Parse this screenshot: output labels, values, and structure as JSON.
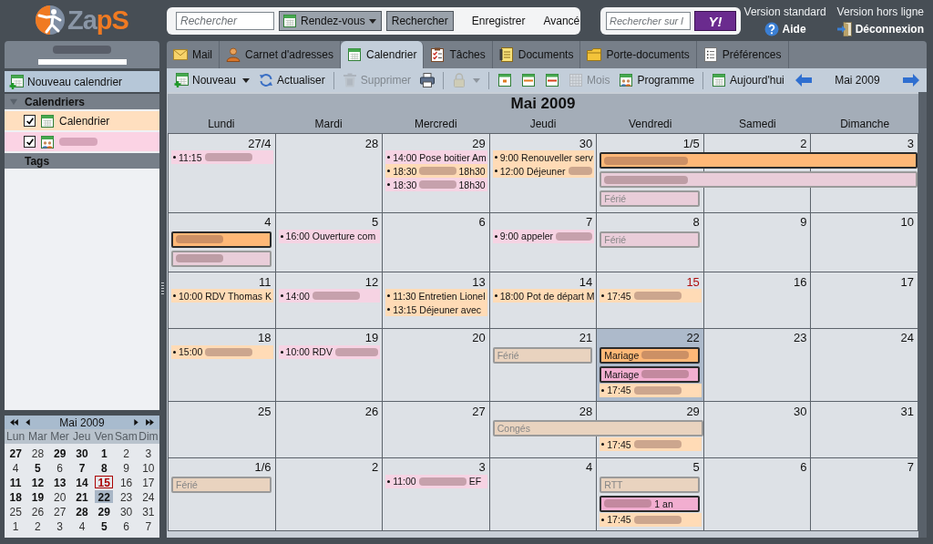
{
  "logo": {
    "parts": [
      "Za",
      "pS"
    ]
  },
  "search": {
    "placeholder": "Rechercher",
    "scope": "Rendez-vous",
    "button": "Rechercher",
    "links": [
      "Enregistrer",
      "Avancé"
    ]
  },
  "web_search": {
    "placeholder": "Rechercher sur l",
    "button": "Y!"
  },
  "header_links": [
    {
      "version": "Version standard",
      "action": "Aide"
    },
    {
      "version": "Version hors ligne",
      "action": "Déconnexion"
    }
  ],
  "sidebar": {
    "user": {
      "redacted": true
    },
    "new_calendar": "Nouveau calendrier",
    "calendars_header": {
      "title": "Calendriers",
      "expanded": true
    },
    "calendars": [
      {
        "kind": "own",
        "label": "Calendrier",
        "redacted": false,
        "checked": true,
        "color": "#ffdfbf"
      },
      {
        "kind": "shared",
        "redacted": true,
        "checked": true,
        "color": "#fbd3e4"
      }
    ],
    "tags_header": {
      "title": "Tags"
    }
  },
  "mini_calendar": {
    "title": "Mai 2009",
    "weekdays": [
      "Lun",
      "Mar",
      "Mer",
      "Jeu",
      "Ven",
      "Sam",
      "Dim"
    ],
    "weeks": [
      [
        {
          "day": "27",
          "has_events": true,
          "today": false,
          "selected": false
        },
        {
          "day": "28",
          "has_events": false,
          "today": false,
          "selected": false
        },
        {
          "day": "29",
          "has_events": true,
          "today": false,
          "selected": false
        },
        {
          "day": "30",
          "has_events": true,
          "today": false,
          "selected": false
        },
        {
          "day": "1",
          "has_events": true,
          "today": false,
          "selected": false
        },
        {
          "day": "2",
          "has_events": false,
          "today": false,
          "selected": false
        },
        {
          "day": "3",
          "has_events": false,
          "today": false,
          "selected": false
        }
      ],
      [
        {
          "day": "4",
          "has_events": false,
          "today": false,
          "selected": false
        },
        {
          "day": "5",
          "has_events": true,
          "today": false,
          "selected": false
        },
        {
          "day": "6",
          "has_events": false,
          "today": false,
          "selected": false
        },
        {
          "day": "7",
          "has_events": true,
          "today": false,
          "selected": false
        },
        {
          "day": "8",
          "has_events": true,
          "today": false,
          "selected": false
        },
        {
          "day": "9",
          "has_events": false,
          "today": false,
          "selected": false
        },
        {
          "day": "10",
          "has_events": false,
          "today": false,
          "selected": false
        }
      ],
      [
        {
          "day": "11",
          "has_events": true,
          "today": false,
          "selected": false
        },
        {
          "day": "12",
          "has_events": true,
          "today": false,
          "selected": false
        },
        {
          "day": "13",
          "has_events": true,
          "today": false,
          "selected": false
        },
        {
          "day": "14",
          "has_events": true,
          "today": false,
          "selected": false
        },
        {
          "day": "15",
          "has_events": true,
          "today": true,
          "selected": false
        },
        {
          "day": "16",
          "has_events": false,
          "today": false,
          "selected": false
        },
        {
          "day": "17",
          "has_events": false,
          "today": false,
          "selected": false
        }
      ],
      [
        {
          "day": "18",
          "has_events": true,
          "today": false,
          "selected": false
        },
        {
          "day": "19",
          "has_events": true,
          "today": false,
          "selected": false
        },
        {
          "day": "20",
          "has_events": false,
          "today": false,
          "selected": false
        },
        {
          "day": "21",
          "has_events": true,
          "today": false,
          "selected": false
        },
        {
          "day": "22",
          "has_events": true,
          "today": false,
          "selected": true
        },
        {
          "day": "23",
          "has_events": false,
          "today": false,
          "selected": false
        },
        {
          "day": "24",
          "has_events": false,
          "today": false,
          "selected": false
        }
      ],
      [
        {
          "day": "25",
          "has_events": false,
          "today": false,
          "selected": false
        },
        {
          "day": "26",
          "has_events": false,
          "today": false,
          "selected": false
        },
        {
          "day": "27",
          "has_events": false,
          "today": false,
          "selected": false
        },
        {
          "day": "28",
          "has_events": true,
          "today": false,
          "selected": false
        },
        {
          "day": "29",
          "has_events": true,
          "today": false,
          "selected": false
        },
        {
          "day": "30",
          "has_events": false,
          "today": false,
          "selected": false
        },
        {
          "day": "31",
          "has_events": false,
          "today": false,
          "selected": false
        }
      ],
      [
        {
          "day": "1",
          "has_events": false,
          "today": false,
          "selected": false
        },
        {
          "day": "2",
          "has_events": false,
          "today": false,
          "selected": false
        },
        {
          "day": "3",
          "has_events": false,
          "today": false,
          "selected": false
        },
        {
          "day": "4",
          "has_events": false,
          "today": false,
          "selected": false
        },
        {
          "day": "5",
          "has_events": true,
          "today": false,
          "selected": false
        },
        {
          "day": "6",
          "has_events": false,
          "today": false,
          "selected": false
        },
        {
          "day": "7",
          "has_events": false,
          "today": false,
          "selected": false
        }
      ]
    ]
  },
  "tabs": [
    {
      "label": "Mail",
      "selected": false
    },
    {
      "label": "Carnet d'adresses",
      "selected": false
    },
    {
      "label": "Calendrier",
      "selected": true
    },
    {
      "label": "Tâches",
      "selected": false
    },
    {
      "label": "Documents",
      "selected": false
    },
    {
      "label": "Porte-documents",
      "selected": false
    },
    {
      "label": "Préférences",
      "selected": false
    }
  ],
  "toolbar": [
    {
      "kind": "button",
      "label": "Nouveau",
      "dropdown": true,
      "disabled": false
    },
    {
      "kind": "button",
      "label": "Actualiser",
      "dropdown": false,
      "disabled": false
    },
    {
      "kind": "separator"
    },
    {
      "kind": "button",
      "label": "Supprimer",
      "dropdown": false,
      "disabled": true
    },
    {
      "kind": "button",
      "dropdown": false,
      "disabled": false
    },
    {
      "kind": "separator"
    },
    {
      "kind": "button",
      "dropdown": true,
      "disabled": true
    },
    {
      "kind": "separator"
    },
    {
      "kind": "button",
      "dropdown": false,
      "disabled": false
    },
    {
      "kind": "button",
      "dropdown": false,
      "disabled": false
    },
    {
      "kind": "button",
      "dropdown": false,
      "disabled": false
    },
    {
      "kind": "button",
      "label": "Mois",
      "dropdown": false,
      "disabled": true
    },
    {
      "kind": "button",
      "label": "Programme",
      "dropdown": false,
      "disabled": false
    },
    {
      "kind": "separator"
    },
    {
      "kind": "button",
      "label": "Aujourd'hui",
      "dropdown": false,
      "disabled": false
    }
  ],
  "period_nav": {
    "label": "Mai 2009"
  },
  "calendar": {
    "title": "Mai 2009",
    "weekdays": [
      "Lundi",
      "Mardi",
      "Mercredi",
      "Jeudi",
      "Vendredi",
      "Samedi",
      "Dimanche"
    ],
    "weeks": [
      {
        "days": [
          {
            "date": "27/4",
            "today": false,
            "selected": false,
            "events": [
              {
                "kind": "timed",
                "time": "11:15",
                "redacted": true,
                "color": "#f6d3e3"
              }
            ]
          },
          {
            "date": "28",
            "today": false,
            "selected": false
          },
          {
            "date": "29",
            "today": false,
            "selected": false,
            "events": [
              {
                "kind": "timed",
                "time": "14:00",
                "title": "Pose boitier Am",
                "redacted": false,
                "color": "#f6d3e3"
              },
              {
                "kind": "timed",
                "time": "18:30",
                "redacted": true,
                "suffix": "18h30",
                "color": "#ffdbb6"
              },
              {
                "kind": "timed",
                "time": "18:30",
                "redacted": true,
                "suffix": "18h30",
                "color": "#f6d3e3"
              }
            ]
          },
          {
            "date": "30",
            "today": false,
            "selected": false,
            "events": [
              {
                "kind": "timed",
                "time": "9:00",
                "title": "Renouveller serv",
                "redacted": false,
                "color": "#ffdbb6"
              },
              {
                "kind": "timed",
                "time": "12:00",
                "title": "Déjeuner",
                "redacted": true,
                "color": "#ffdbb6"
              }
            ]
          },
          {
            "date": "1/5",
            "today": false,
            "selected": false,
            "events": [
              {
                "kind": "allday",
                "redacted": true,
                "color": "#ffb877"
              },
              {
                "kind": "tentative",
                "redacted": true,
                "color": "#e9cdd9"
              },
              {
                "kind": "tentative",
                "title": "Férié",
                "redacted": false,
                "color": "#e9cdd9"
              }
            ]
          },
          {
            "date": "2",
            "today": false,
            "selected": false,
            "events": [
              {
                "kind": "continuation"
              },
              {
                "kind": "continuation"
              }
            ]
          },
          {
            "date": "3",
            "today": false,
            "selected": false,
            "events": [
              {
                "kind": "continuation"
              },
              {
                "kind": "continuation"
              }
            ]
          }
        ]
      },
      {
        "days": [
          {
            "date": "4",
            "today": false,
            "selected": false,
            "events": [
              {
                "kind": "allday",
                "redacted": true,
                "color": "#ffb877"
              },
              {
                "kind": "tentative",
                "redacted": true,
                "color": "#e9cdd9"
              }
            ]
          },
          {
            "date": "5",
            "today": false,
            "selected": false,
            "events": [
              {
                "kind": "timed",
                "time": "16:00",
                "title": "Ouverture com",
                "redacted": false,
                "color": "#f6d3e3"
              }
            ]
          },
          {
            "date": "6",
            "today": false,
            "selected": false
          },
          {
            "date": "7",
            "today": false,
            "selected": false,
            "events": [
              {
                "kind": "timed",
                "time": "9:00",
                "title": "appeler",
                "redacted": true,
                "color": "#f6d3e3"
              }
            ]
          },
          {
            "date": "8",
            "today": false,
            "selected": false,
            "events": [
              {
                "kind": "tentative",
                "title": "Férié",
                "redacted": false,
                "color": "#e9cdd9"
              }
            ]
          },
          {
            "date": "9",
            "today": false,
            "selected": false
          },
          {
            "date": "10",
            "today": false,
            "selected": false
          }
        ]
      },
      {
        "days": [
          {
            "date": "11",
            "today": false,
            "selected": false,
            "events": [
              {
                "kind": "timed",
                "time": "10:00",
                "title": "RDV Thomas K",
                "redacted": false,
                "color": "#ffdbb6"
              }
            ]
          },
          {
            "date": "12",
            "today": false,
            "selected": false,
            "events": [
              {
                "kind": "timed",
                "time": "14:00",
                "redacted": true,
                "color": "#f6d3e3"
              }
            ]
          },
          {
            "date": "13",
            "today": false,
            "selected": false,
            "events": [
              {
                "kind": "timed",
                "time": "11:30",
                "title": "Entretien Lionel",
                "redacted": false,
                "color": "#ffdbb6"
              },
              {
                "kind": "timed",
                "time": "13:15",
                "title": "Déjeuner avec",
                "redacted": false,
                "color": "#ffdbb6"
              }
            ]
          },
          {
            "date": "14",
            "today": false,
            "selected": false,
            "events": [
              {
                "kind": "timed",
                "time": "18:00",
                "title": "Pot de départ M",
                "redacted": false,
                "color": "#ffdbb6"
              }
            ]
          },
          {
            "date": "15",
            "today": true,
            "selected": false,
            "events": [
              {
                "kind": "timed",
                "time": "17:45",
                "redacted": true,
                "color": "#ffdbb6"
              }
            ]
          },
          {
            "date": "16",
            "today": false,
            "selected": false
          },
          {
            "date": "17",
            "today": false,
            "selected": false
          }
        ]
      },
      {
        "days": [
          {
            "date": "18",
            "today": false,
            "selected": false,
            "events": [
              {
                "kind": "timed",
                "time": "15:00",
                "redacted": true,
                "color": "#ffdbb6"
              }
            ]
          },
          {
            "date": "19",
            "today": false,
            "selected": false,
            "events": [
              {
                "kind": "timed",
                "time": "10:00",
                "title": "RDV",
                "redacted": true,
                "color": "#f6d3e3"
              }
            ]
          },
          {
            "date": "20",
            "today": false,
            "selected": false
          },
          {
            "date": "21",
            "today": false,
            "selected": false,
            "events": [
              {
                "kind": "tentative",
                "title": "Férié",
                "redacted": false,
                "color": "#e9d3bf"
              }
            ]
          },
          {
            "date": "22",
            "today": false,
            "selected": true,
            "events": [
              {
                "kind": "allday",
                "title": "Mariage",
                "redacted": true,
                "color": "#ffb877"
              },
              {
                "kind": "allday",
                "title": "Mariage",
                "redacted": true,
                "color": "#f2aed0"
              },
              {
                "kind": "timed",
                "time": "17:45",
                "redacted": true,
                "color": "#ffdbb6"
              }
            ]
          },
          {
            "date": "23",
            "today": false,
            "selected": false
          },
          {
            "date": "24",
            "today": false,
            "selected": false
          }
        ]
      },
      {
        "days": [
          {
            "date": "25",
            "today": false,
            "selected": false
          },
          {
            "date": "26",
            "today": false,
            "selected": false
          },
          {
            "date": "27",
            "today": false,
            "selected": false
          },
          {
            "date": "28",
            "today": false,
            "selected": false,
            "events": [
              {
                "kind": "tentative",
                "title": "Congés",
                "redacted": false,
                "color": "#e9d3bf"
              }
            ]
          },
          {
            "date": "29",
            "today": false,
            "selected": false,
            "events": [
              {
                "kind": "continuation"
              },
              {
                "kind": "timed",
                "time": "17:45",
                "redacted": true,
                "color": "#ffdbb6"
              }
            ]
          },
          {
            "date": "30",
            "today": false,
            "selected": false
          },
          {
            "date": "31",
            "today": false,
            "selected": false
          }
        ]
      },
      {
        "days": [
          {
            "date": "1/6",
            "today": false,
            "selected": false,
            "events": [
              {
                "kind": "tentative",
                "title": "Férié",
                "redacted": false,
                "color": "#e9d3bf"
              }
            ]
          },
          {
            "date": "2",
            "today": false,
            "selected": false
          },
          {
            "date": "3",
            "today": false,
            "selected": false,
            "events": [
              {
                "kind": "timed",
                "time": "11:00",
                "redacted": true,
                "suffix": "EF",
                "color": "#f6d3e3"
              }
            ]
          },
          {
            "date": "4",
            "today": false,
            "selected": false
          },
          {
            "date": "5",
            "today": false,
            "selected": false,
            "events": [
              {
                "kind": "tentative",
                "title": "RTT",
                "redacted": false,
                "color": "#e9d3bf"
              },
              {
                "kind": "allday",
                "redacted": true,
                "suffix": "1 an",
                "color": "#f2aed0"
              },
              {
                "kind": "timed",
                "time": "17:45",
                "redacted": true,
                "color": "#ffdbb6"
              }
            ]
          },
          {
            "date": "6",
            "today": false,
            "selected": false
          },
          {
            "date": "7",
            "today": false,
            "selected": false
          }
        ]
      }
    ]
  }
}
